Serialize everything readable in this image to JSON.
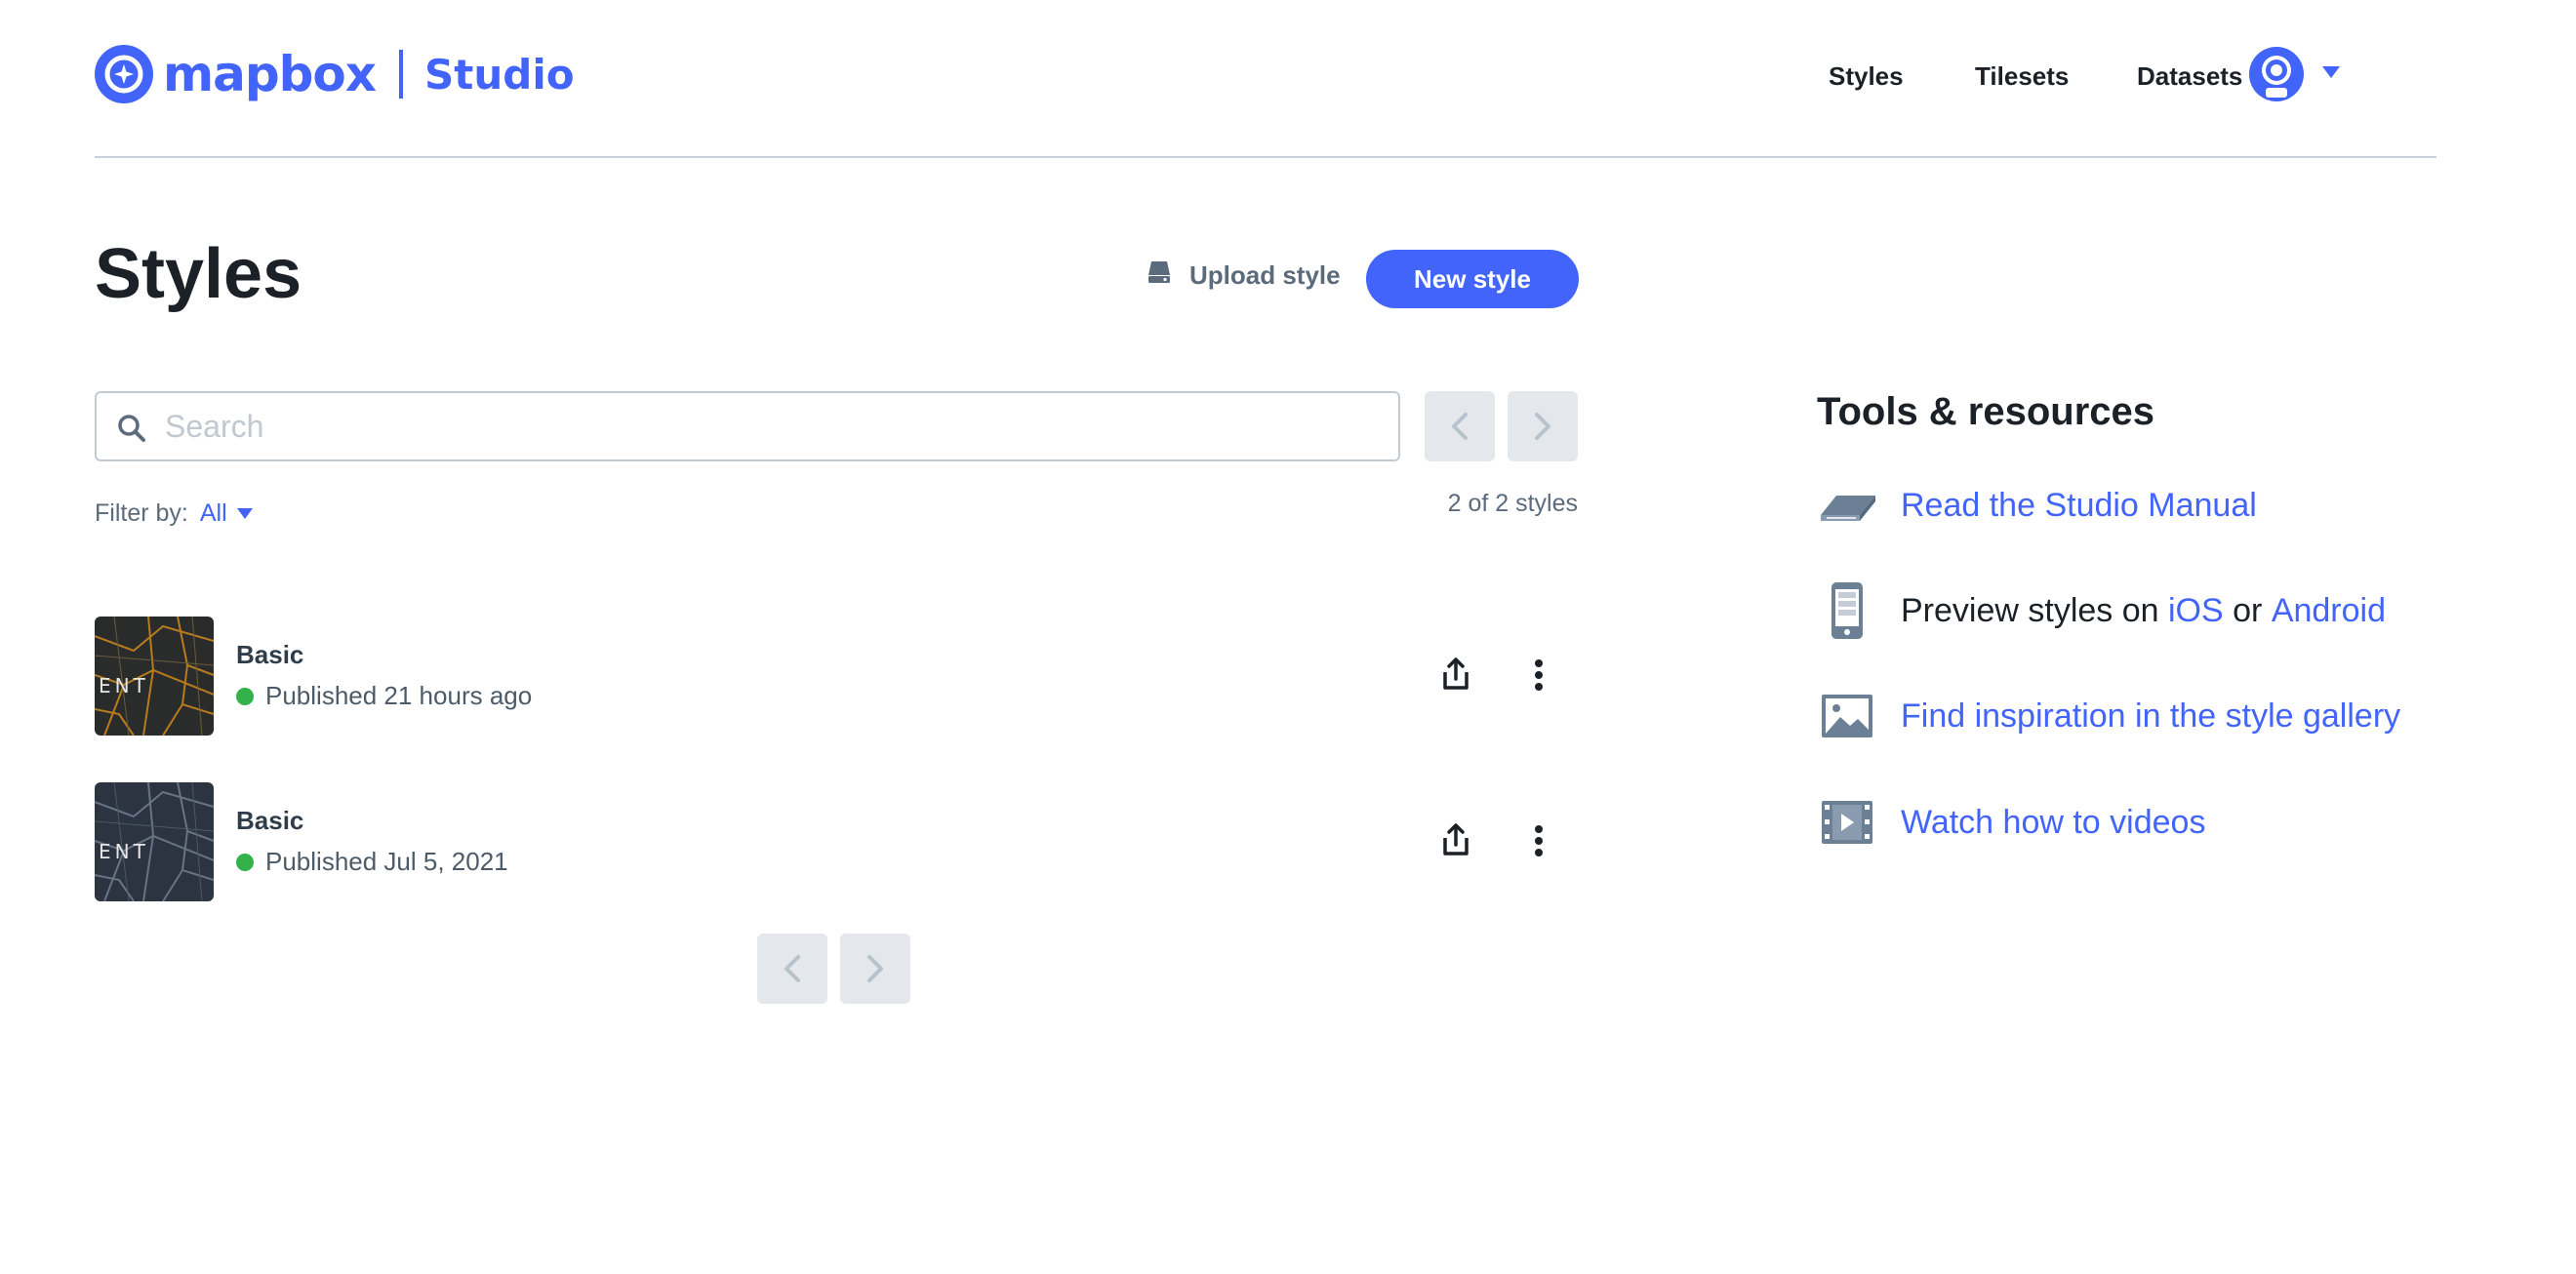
{
  "header": {
    "logo_word": "mapbox",
    "logo_product": "Studio",
    "nav": [
      "Styles",
      "Tilesets",
      "Datasets"
    ],
    "avatar_icon": "user-avatar-icon"
  },
  "page": {
    "title": "Styles",
    "upload_label": "Upload style",
    "new_style_label": "New style"
  },
  "search": {
    "placeholder": "Search",
    "value": ""
  },
  "filter": {
    "label": "Filter by:",
    "value": "All"
  },
  "count_text": "2 of 2 styles",
  "styles": [
    {
      "name": "Basic",
      "status": "Published 21 hours ago",
      "thumb_text": "ENT",
      "thumb_theme": "dark-orange"
    },
    {
      "name": "Basic",
      "status": "Published Jul 5, 2021",
      "thumb_text": "ENT",
      "thumb_theme": "dark-gray"
    }
  ],
  "tools": {
    "title": "Tools & resources",
    "manual": "Read the Studio Manual",
    "preview_prefix": "Preview styles on ",
    "preview_ios": "iOS",
    "preview_or": " or ",
    "preview_android": "Android",
    "gallery": "Find inspiration in the style gallery",
    "videos": "Watch how to videos"
  },
  "colors": {
    "brand": "#4264fb",
    "status_published": "#33b24a",
    "text_dark": "#1b2127",
    "text_muted": "#5b6b7c"
  }
}
